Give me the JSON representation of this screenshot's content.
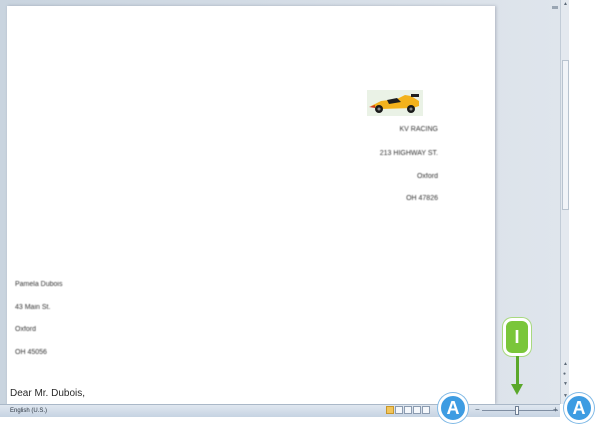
{
  "document": {
    "sender_lines": [
      "KV RACING",
      "213 HIGHWAY ST.",
      "Oxford",
      "OH 47826"
    ],
    "recipient_lines": [
      "Pamela Dubois",
      "43 Main St.",
      "Oxford",
      "OH 45056"
    ],
    "salutation": "Dear Mr. Dubois,"
  },
  "statusbar": {
    "language": "English (U.S.)"
  },
  "callouts": {
    "left": "A",
    "right": "A",
    "step": "I"
  },
  "colors": {
    "callout_blue": "#3d9ce2",
    "callout_green": "#7ac63a",
    "workspace": "#d6dee7"
  }
}
